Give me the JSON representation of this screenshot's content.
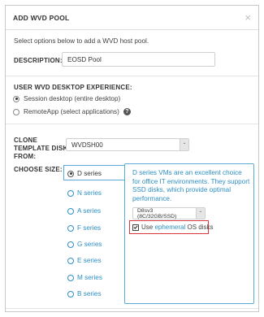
{
  "dialog": {
    "title": "ADD WVD POOL",
    "close_glyph": "×",
    "intro": "Select options below to add a WVD host pool.",
    "description": {
      "label": "DESCRIPTION:",
      "value": "EOSD Pool"
    },
    "experience": {
      "label": "USER WVD DESKTOP EXPERIENCE:",
      "options": [
        {
          "label": "Session desktop (entire desktop)",
          "selected": true
        },
        {
          "label": "RemoteApp (select applications)",
          "selected": false
        }
      ],
      "help_glyph": "?"
    },
    "clone": {
      "label_line1": "CLONE",
      "label_line2": "TEMPLATE DISK",
      "label_line3": "FROM:",
      "value": "WVDSH00",
      "arrow": "⌃"
    },
    "size": {
      "label": "CHOOSE SIZE:",
      "series": [
        {
          "label": "D series",
          "selected": true
        },
        {
          "label": "N series",
          "selected": false
        },
        {
          "label": "A series",
          "selected": false
        },
        {
          "label": "F series",
          "selected": false
        },
        {
          "label": "G series",
          "selected": false
        },
        {
          "label": "E series",
          "selected": false
        },
        {
          "label": "M series",
          "selected": false
        },
        {
          "label": "B series",
          "selected": false
        }
      ],
      "description": "D series VMs are an excellent choice for office IT environments. They support SSD disks, which provide optimal performance.",
      "vm_size": "D8sv3 (8C/32GB/SSD)",
      "ephemeral": {
        "checked": true,
        "prefix": "Use ",
        "link": "ephemeral",
        "suffix": " OS disks"
      }
    }
  },
  "colors": {
    "accent": "#2f8fc4",
    "highlight": "#d9363e"
  }
}
